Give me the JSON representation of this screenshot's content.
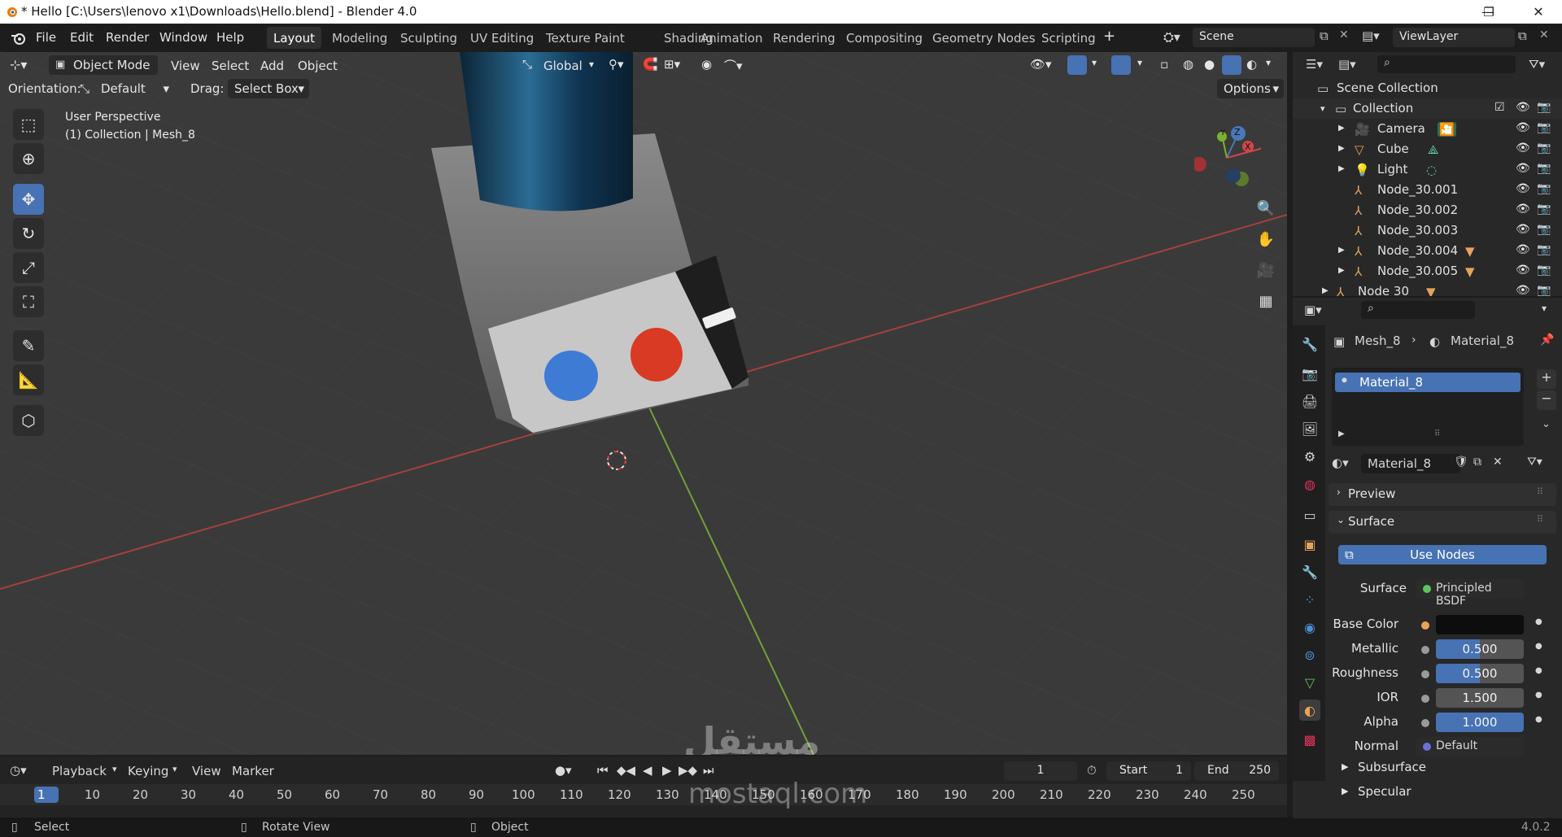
{
  "window": {
    "title": "* Hello [C:\\Users\\lenovo x1\\Downloads\\Hello.blend] - Blender 4.0",
    "controls": {
      "minimize": "—",
      "maximize": "❐",
      "close": "✕"
    }
  },
  "menu": {
    "file": "File",
    "edit": "Edit",
    "render": "Render",
    "window": "Window",
    "help": "Help"
  },
  "workspaces": [
    "Layout",
    "Modeling",
    "Sculpting",
    "UV Editing",
    "Texture Paint",
    "Shading",
    "Animation",
    "Rendering",
    "Compositing",
    "Geometry Nodes",
    "Scripting"
  ],
  "scene_field": "Scene",
  "viewlayer_field": "ViewLayer",
  "viewport_header": {
    "mode": "Object Mode",
    "view": "View",
    "select": "Select",
    "add": "Add",
    "object": "Object",
    "transform_orientation": "Global",
    "orientation_label": "Orientation:",
    "orientation_value": "Default",
    "drag_label": "Drag:",
    "drag_value": "Select Box",
    "options": "Options"
  },
  "viewport_info": {
    "perspective": "User Perspective",
    "collection": "(1) Collection | Mesh_8"
  },
  "gizmo": {
    "x": "X",
    "y": "Y",
    "z": "Z"
  },
  "outliner": {
    "scene_collection": "Scene Collection",
    "collection": "Collection",
    "items": [
      {
        "label": "Camera"
      },
      {
        "label": "Cube"
      },
      {
        "label": "Light"
      },
      {
        "label": "Node_30.001"
      },
      {
        "label": "Node_30.002"
      },
      {
        "label": "Node_30.003"
      },
      {
        "label": "Node_30.004"
      },
      {
        "label": "Node_30.005"
      }
    ],
    "last_item": "Node 30"
  },
  "properties": {
    "breadcrumb_mesh": "Mesh_8",
    "breadcrumb_material": "Material_8",
    "slot_material": "Material_8",
    "material_name": "Material_8",
    "panels": {
      "preview": "Preview",
      "surface": "Surface",
      "use_nodes": "Use Nodes",
      "subsurface": "Subsurface",
      "specular": "Specular"
    },
    "surface_label": "Surface",
    "surface_value": "Principled BSDF",
    "fields": [
      {
        "label": "Base Color",
        "value": "",
        "fraction": 0,
        "color": "#0d0d0d"
      },
      {
        "label": "Metallic",
        "value": "0.500",
        "fraction": 0.5
      },
      {
        "label": "Roughness",
        "value": "0.500",
        "fraction": 0.5
      },
      {
        "label": "IOR",
        "value": "1.500",
        "fraction": 0
      },
      {
        "label": "Alpha",
        "value": "1.000",
        "fraction": 1.0
      }
    ],
    "normal_label": "Normal",
    "normal_value": "Default"
  },
  "timeline": {
    "playback": "Playback",
    "keying": "Keying",
    "view": "View",
    "marker": "Marker",
    "current_frame": "1",
    "start_label": "Start",
    "start_value": "1",
    "end_label": "End",
    "end_value": "250",
    "frames": [
      "1",
      "10",
      "20",
      "30",
      "40",
      "50",
      "60",
      "70",
      "80",
      "90",
      "100",
      "110",
      "120",
      "130",
      "140",
      "150",
      "160",
      "170",
      "180",
      "190",
      "200",
      "210",
      "220",
      "230",
      "240",
      "250"
    ]
  },
  "statusbar": {
    "select": "Select",
    "rotate_view": "Rotate View",
    "object": "Object",
    "version": "4.0.2"
  },
  "watermark": {
    "arabic": "مستقل",
    "latin": "mostaql.com"
  },
  "colors": {
    "accent": "#4772b3",
    "viewport_bg": "#3a3a3a",
    "red_button": "#d93a23",
    "blue_button": "#3e7bd4"
  }
}
